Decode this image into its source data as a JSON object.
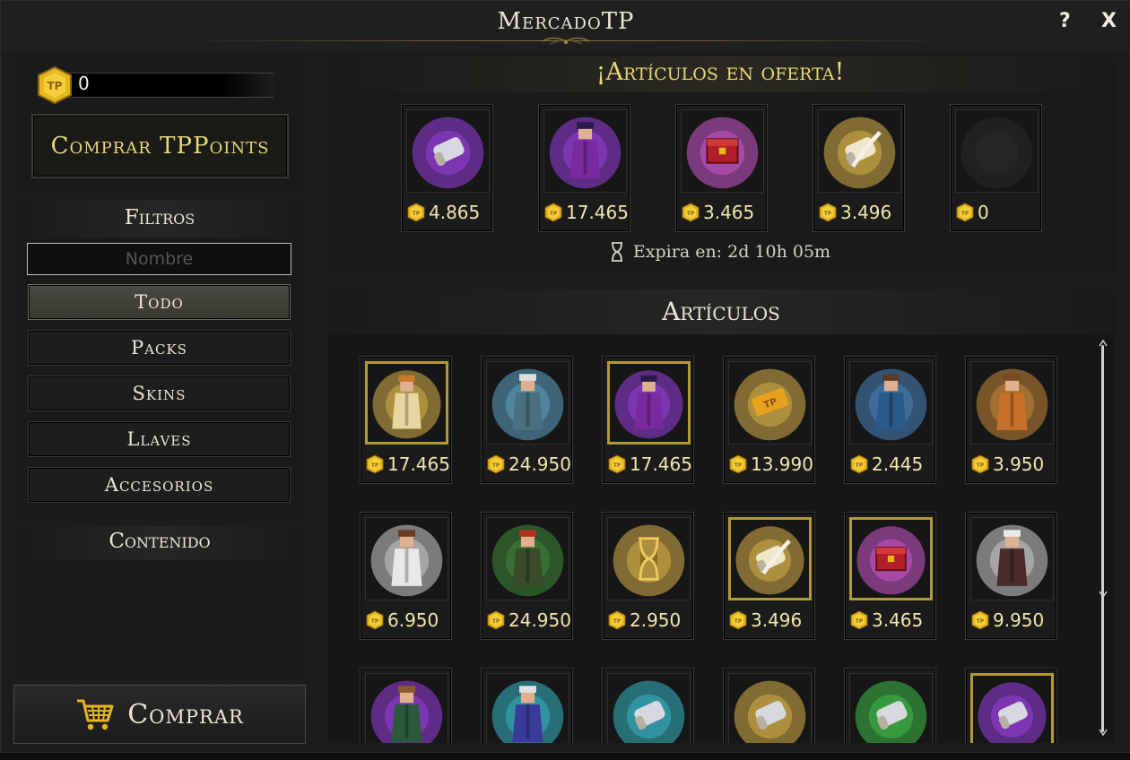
{
  "window": {
    "title": "MercadoTP",
    "help_label": "?",
    "close_label": "X"
  },
  "balance": {
    "tp_points": "0"
  },
  "buy_tp_button": "Comprar TPPoints",
  "filters": {
    "title": "Filtros",
    "name_placeholder": "Nombre",
    "categories": [
      {
        "label": "Todo",
        "active": true
      },
      {
        "label": "Packs",
        "active": false
      },
      {
        "label": "Skins",
        "active": false
      },
      {
        "label": "Llaves",
        "active": false
      },
      {
        "label": "Accesorios",
        "active": false
      }
    ]
  },
  "contents": {
    "title": "Contenido"
  },
  "buy_button": "Comprar",
  "offers": {
    "title": "¡Artículos en oferta!",
    "expires": "Expira en: 2d 10h 05m",
    "items": [
      {
        "icon": "purple-scroll-icon",
        "price": "4.865"
      },
      {
        "icon": "purple-robed-character-icon",
        "price": "17.465"
      },
      {
        "icon": "rainbow-chest-icon",
        "price": "3.465"
      },
      {
        "icon": "feather-scroll-icon",
        "price": "3.496"
      },
      {
        "icon": "empty-slot-icon",
        "price": "0"
      }
    ]
  },
  "articles": {
    "title": "Artículos",
    "items": [
      {
        "icon": "golden-elf-character-icon",
        "price": "17.465",
        "highlight": true
      },
      {
        "icon": "skeleton-mage-character-icon",
        "price": "24.950",
        "highlight": false
      },
      {
        "icon": "purple-robed-character-icon",
        "price": "17.465",
        "highlight": true
      },
      {
        "icon": "tp-ticket-icon",
        "price": "13.990",
        "highlight": false
      },
      {
        "icon": "blue-robed-character-icon",
        "price": "2.445",
        "highlight": false
      },
      {
        "icon": "orange-robed-character-icon",
        "price": "3.950",
        "highlight": false
      },
      {
        "icon": "white-priest-character-icon",
        "price": "6.950",
        "highlight": false
      },
      {
        "icon": "red-haired-druid-character-icon",
        "price": "24.950",
        "highlight": false
      },
      {
        "icon": "golden-hourglass-icon",
        "price": "2.950",
        "highlight": false
      },
      {
        "icon": "feather-scroll-icon",
        "price": "3.496",
        "highlight": true
      },
      {
        "icon": "rainbow-chest-icon",
        "price": "3.465",
        "highlight": true
      },
      {
        "icon": "white-haired-warrior-character-icon",
        "price": "9.950",
        "highlight": false
      },
      {
        "icon": "green-archer-character-icon",
        "price": "",
        "highlight": false
      },
      {
        "icon": "cyan-armored-character-icon",
        "price": "",
        "highlight": false
      },
      {
        "icon": "cyan-scroll-icon",
        "price": "",
        "highlight": false
      },
      {
        "icon": "golden-scroll-icon",
        "price": "",
        "highlight": false
      },
      {
        "icon": "green-scroll-icon",
        "price": "",
        "highlight": false
      },
      {
        "icon": "purple-scroll-icon",
        "price": "",
        "highlight": true
      }
    ]
  },
  "colors": {
    "gold_text": "#e7d77b",
    "highlight_border": "#b29a36",
    "background": "#1c1c1d"
  }
}
